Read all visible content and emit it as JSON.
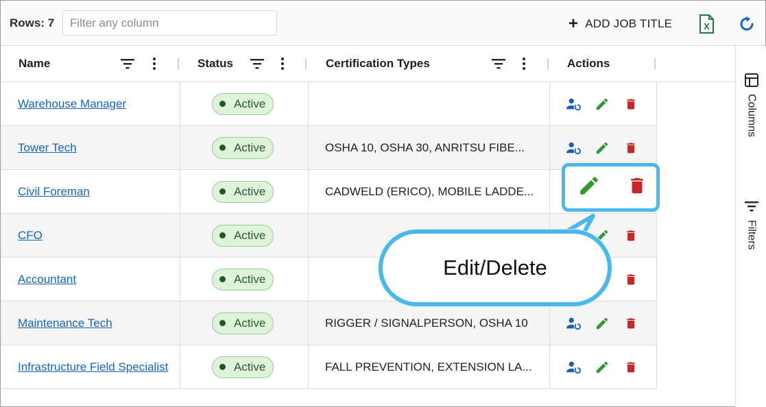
{
  "toolbar": {
    "rows_label": "Rows: 7",
    "filter_placeholder": "Filter any column",
    "add_button_label": "ADD JOB TITLE",
    "excel_icon": "excel-export-icon",
    "refresh_icon": "refresh-icon"
  },
  "columns": {
    "name": "Name",
    "status": "Status",
    "certification_types": "Certification Types",
    "actions": "Actions"
  },
  "rows": [
    {
      "name": "Warehouse Manager",
      "status": "Active",
      "certifications": ""
    },
    {
      "name": "Tower Tech",
      "status": "Active",
      "certifications": "OSHA 10, OSHA 30, ANRITSU FIBE..."
    },
    {
      "name": "Civil Foreman",
      "status": "Active",
      "certifications": "CADWELD (ERICO), MOBILE LADDE..."
    },
    {
      "name": "CFO",
      "status": "Active",
      "certifications": ""
    },
    {
      "name": "Accountant",
      "status": "Active",
      "certifications": ""
    },
    {
      "name": "Maintenance Tech",
      "status": "Active",
      "certifications": "RIGGER / SIGNALPERSON, OSHA 10"
    },
    {
      "name": "Infrastructure Field Specialist",
      "status": "Active",
      "certifications": "FALL PREVENTION, EXTENSION LA..."
    }
  ],
  "side_panel": {
    "columns_label": "Columns",
    "filters_label": "Filters"
  },
  "callout": {
    "text": "Edit/Delete"
  },
  "colors": {
    "link": "#1565c0",
    "active_badge_bg": "#dff2dc",
    "edit_icon": "#2e9a2e",
    "delete_icon": "#c62828",
    "assign_icon": "#1a5fb4",
    "callout_border": "#4bb8ec"
  }
}
